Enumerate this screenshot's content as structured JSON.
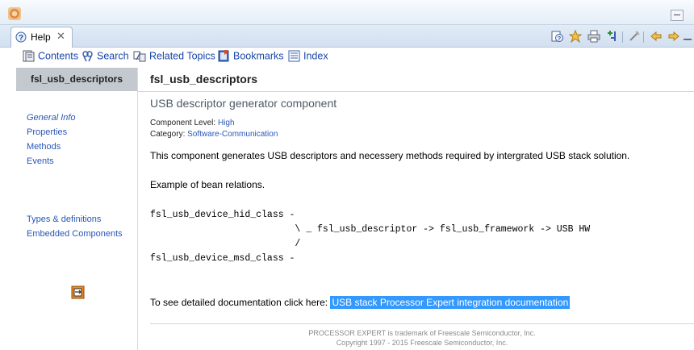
{
  "tab": {
    "label": "Help"
  },
  "navbar": [
    {
      "label": "Contents",
      "icon": "contents-icon"
    },
    {
      "label": "Search",
      "icon": "search-icon"
    },
    {
      "label": "Related Topics",
      "icon": "related-topics-icon"
    },
    {
      "label": "Bookmarks",
      "icon": "bookmarks-icon"
    },
    {
      "label": "Index",
      "icon": "index-icon"
    }
  ],
  "sidebar": {
    "component": "fsl_usb_descriptors",
    "links": [
      "General Info",
      "Properties",
      "Methods",
      "Events",
      "Types & definitions",
      "Embedded Components"
    ]
  },
  "content": {
    "title": "fsl_usb_descriptors",
    "subtitle": "USB descriptor generator component",
    "component_level_label": "Component Level:",
    "component_level": "High",
    "category_label": "Category:",
    "category": "Software-Communication",
    "description": "This component generates USB descriptors and necessery methods required by intergrated USB stack solution.",
    "example_heading": "Example of bean relations.",
    "code": [
      "fsl_usb_device_hid_class -",
      "                          \\ _ fsl_usb_descriptor -> fsl_usb_framework -> USB HW",
      "                          /",
      "fsl_usb_device_msd_class -"
    ],
    "doc_prefix": "To see detailed documentation click here:",
    "doc_link": "USB stack Processor Expert integration documentation",
    "footer1": "PROCESSOR EXPERT is trademark of Freescale Semiconductor, Inc.",
    "footer2": "Copyright 1997 - 2015 Freescale Semiconductor, Inc."
  },
  "colors": {
    "link": "#2a57b8",
    "nav_link": "#1846a8",
    "selection": "#3399ff",
    "component_tab": "#c3c9cf"
  }
}
